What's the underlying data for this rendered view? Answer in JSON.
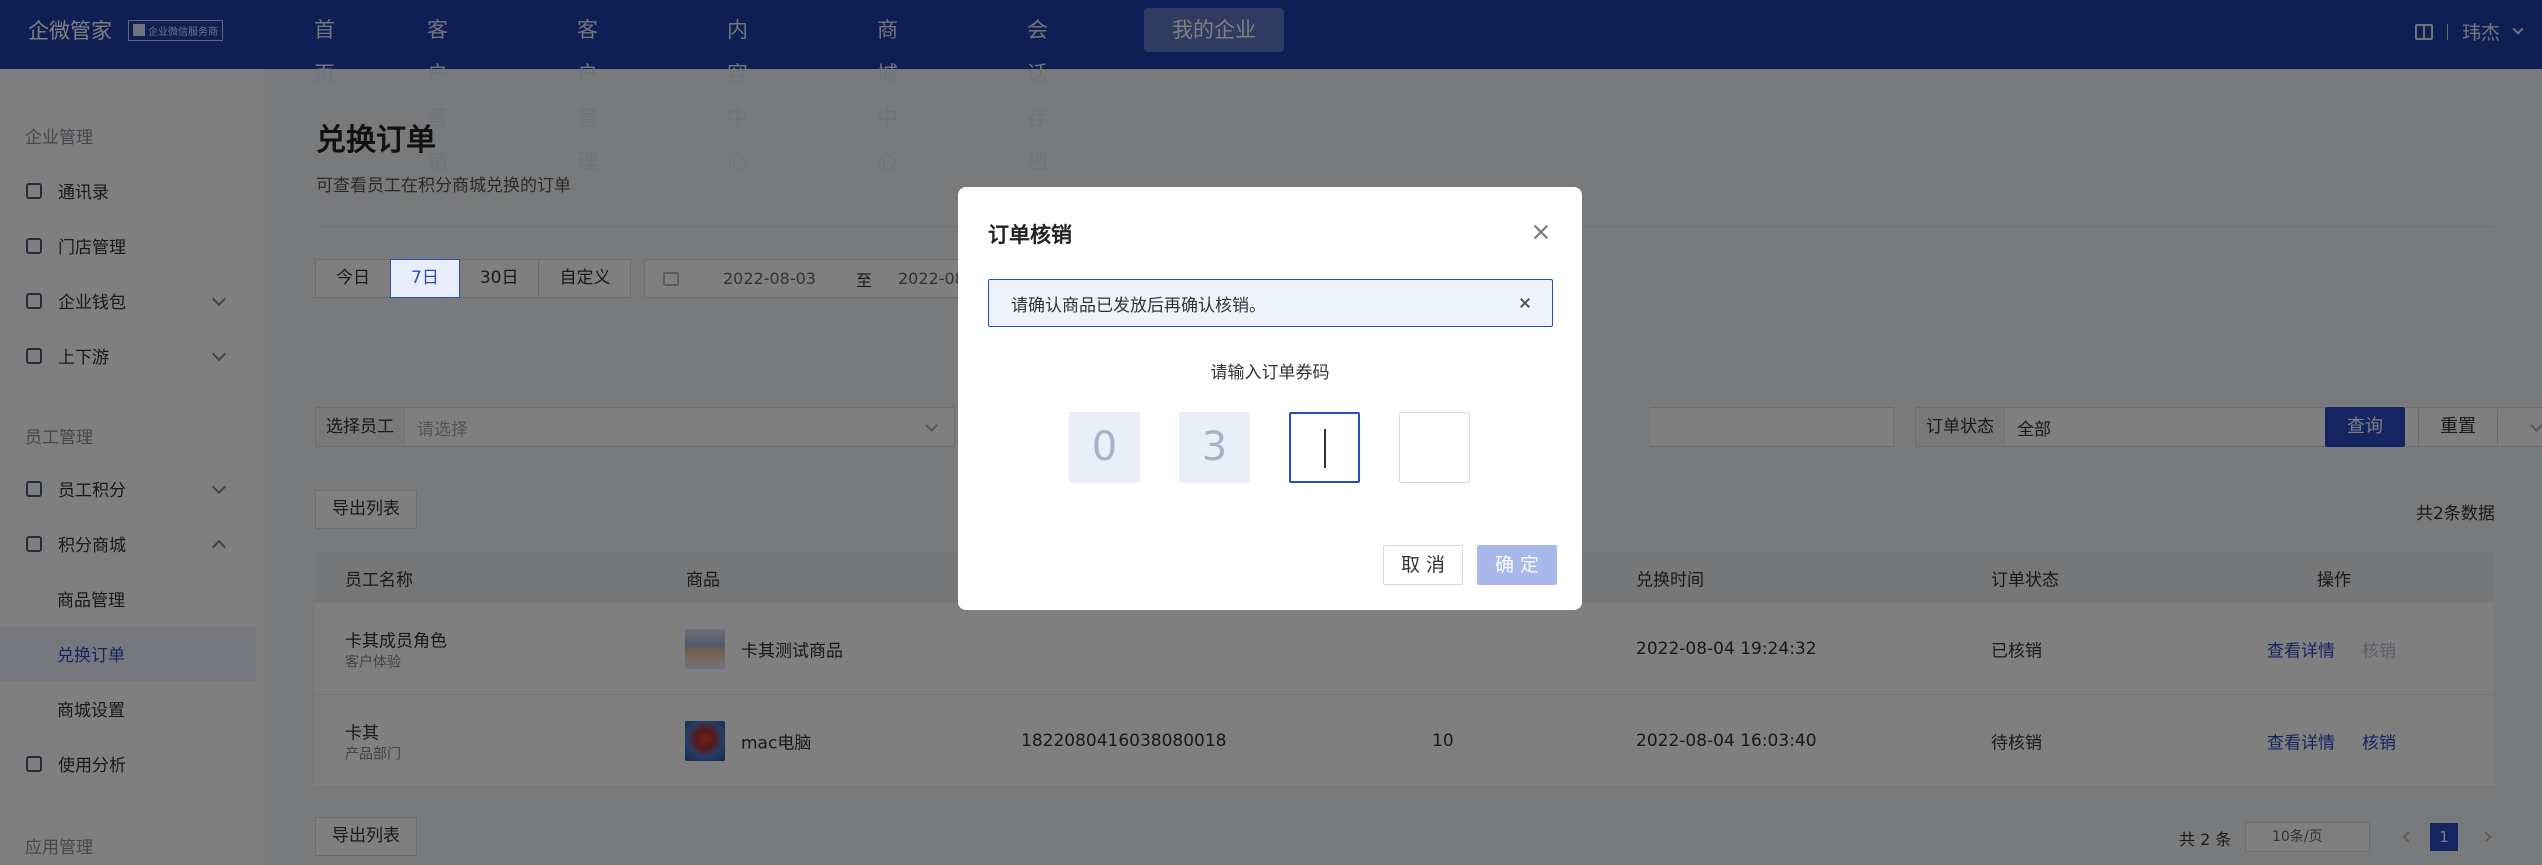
{
  "brand": {
    "name": "企微管家",
    "badge": "企业微信服务商"
  },
  "nav": {
    "items": [
      "首页",
      "客户营销",
      "客户管理",
      "内容中心",
      "商城中心",
      "会话存档",
      "我的企业"
    ],
    "active": "我的企业"
  },
  "user": {
    "name": "玮杰"
  },
  "sidebar": {
    "groups": [
      "企业管理",
      "员工管理",
      "应用管理"
    ],
    "items": [
      "通讯录",
      "门店管理",
      "企业钱包",
      "上下游",
      "员工积分",
      "积分商城",
      "使用分析"
    ],
    "sub_items": [
      "商品管理",
      "兑换订单",
      "商城设置"
    ],
    "active": "兑换订单"
  },
  "page": {
    "title": "兑换订单",
    "description": "可查看员工在积分商城兑换的订单"
  },
  "date_filter": {
    "options": [
      "今日",
      "7日",
      "30日",
      "自定义"
    ],
    "active": "7日",
    "start": "2022-08-03",
    "separator": "至",
    "end_partial": "2022-08"
  },
  "filters": {
    "employee_label": "选择员工",
    "employee_placeholder": "请选择",
    "status_label": "订单状态",
    "status_value": "全部",
    "query_button": "查询",
    "reset_button": "重置"
  },
  "export_button": "导出列表",
  "total_text": "共2条数据",
  "table": {
    "columns": [
      "员工名称",
      "商品",
      "兑换时间",
      "订单状态",
      "操作"
    ],
    "rows": [
      {
        "name": "卡其成员角色",
        "dept": "客户体验",
        "product": "卡其测试商品",
        "order_no": "",
        "points": "",
        "time": "2022-08-04 19:24:32",
        "status": "已核销",
        "action_detail": "查看详情",
        "action_verify": "核销"
      },
      {
        "name": "卡其",
        "dept": "产品部门",
        "product": "mac电脑",
        "order_no": "1822080416038080018",
        "points": "10",
        "time": "2022-08-04 16:03:40",
        "status": "待核销",
        "action_detail": "查看详情",
        "action_verify": "核销"
      }
    ]
  },
  "pagination": {
    "total": "共 2 条",
    "page_size": "10条/页",
    "current": "1"
  },
  "modal": {
    "title": "订单核销",
    "alert": "请确认商品已发放后再确认核销。",
    "code_label": "请输入订单券码",
    "code_digits": [
      "0",
      "3",
      "",
      ""
    ],
    "cancel": "取 消",
    "confirm": "确 定"
  },
  "colors": {
    "nav_bg": "#1f3fa6",
    "primary": "#2b4bc4",
    "confirm_disabled": "#a9b8ea"
  }
}
